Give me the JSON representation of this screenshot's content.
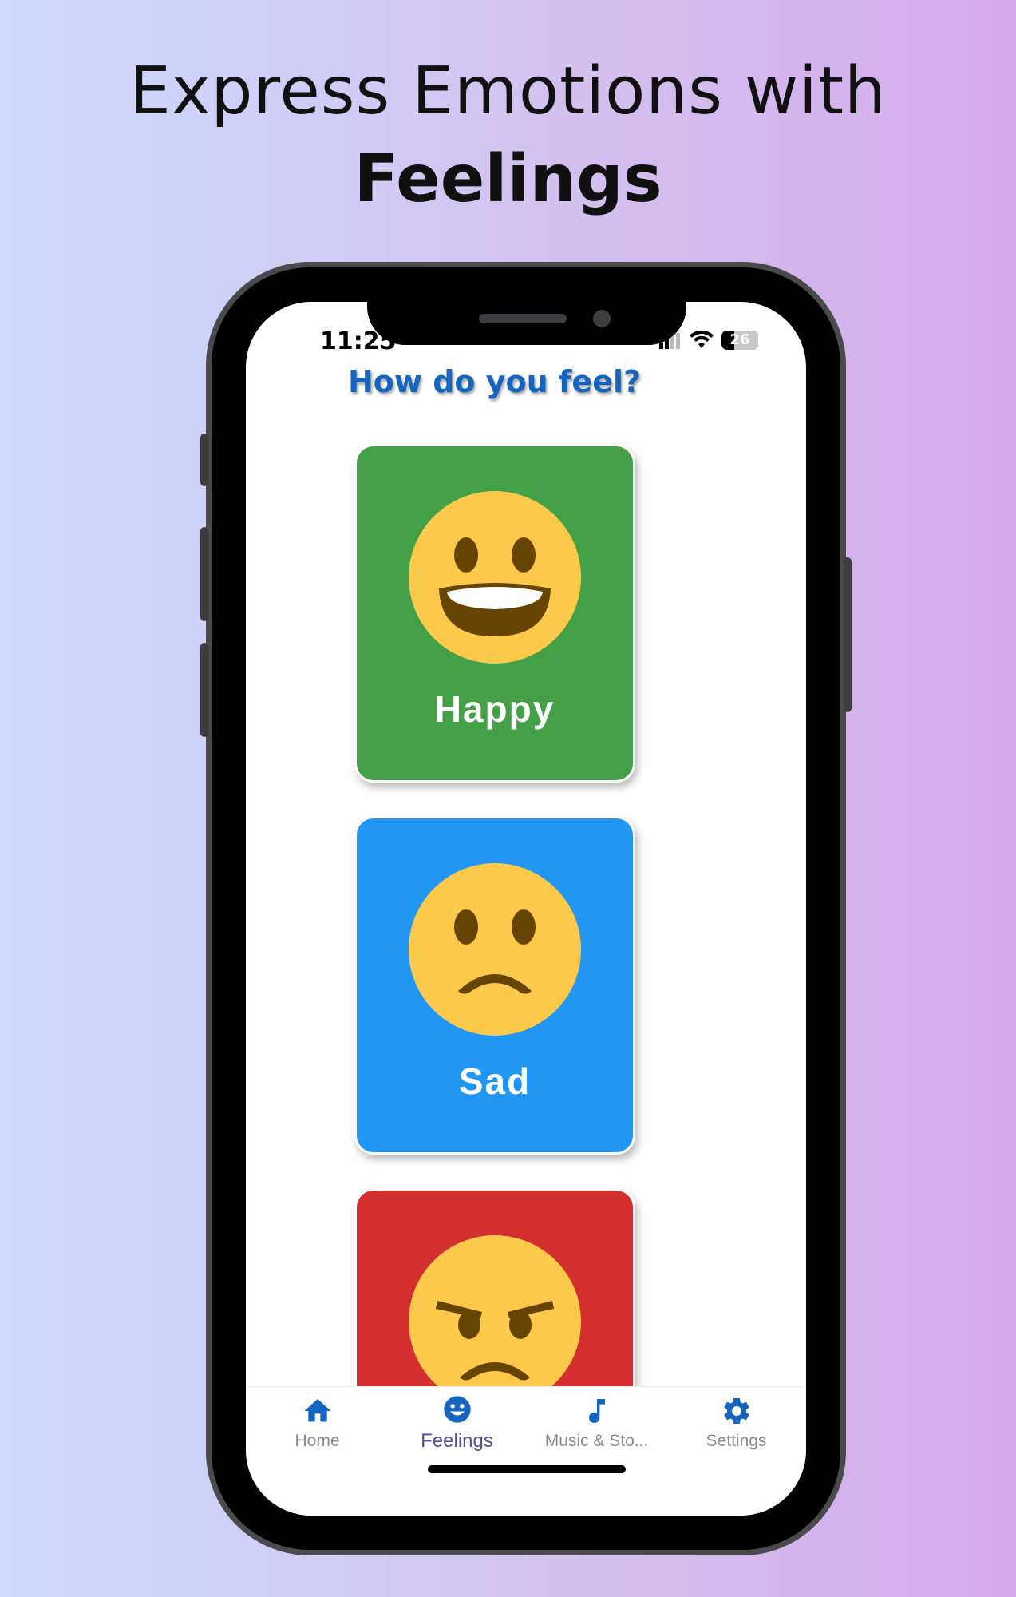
{
  "headline": {
    "line1": "Express Emotions with",
    "line2": "Feelings"
  },
  "status": {
    "time": "11:25",
    "battery": "26"
  },
  "screen_title": "How do you feel?",
  "cards": [
    {
      "label": "Happy",
      "color": "#43a047",
      "emoji": "grinning-face"
    },
    {
      "label": "Sad",
      "color": "#2196f3",
      "emoji": "frowning-face"
    },
    {
      "label": "",
      "color": "#d32f2f",
      "emoji": "angry-face"
    }
  ],
  "tabs": [
    {
      "label": "Home",
      "icon": "home-icon",
      "active": false
    },
    {
      "label": "Feelings",
      "icon": "smiley-icon",
      "active": true
    },
    {
      "label": "Music & Sto...",
      "icon": "music-note-icon",
      "active": false
    },
    {
      "label": "Settings",
      "icon": "gear-icon",
      "active": false
    }
  ],
  "colors": {
    "accent": "#1565c0",
    "active_tab": "#5a4e9a",
    "face": "#fdc94b"
  }
}
